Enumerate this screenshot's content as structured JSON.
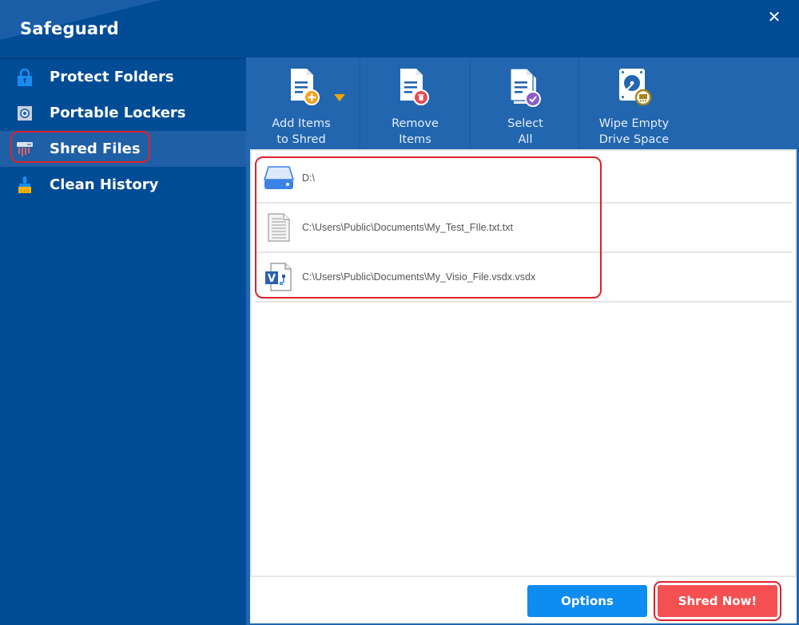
{
  "window": {
    "title": "Safeguard",
    "close_icon": "close-icon",
    "close_glyph": "✕"
  },
  "sidebar": {
    "items": [
      {
        "label": "Protect Folders",
        "icon": "lock-icon",
        "active": false
      },
      {
        "label": "Portable Lockers",
        "icon": "safe-icon",
        "active": false
      },
      {
        "label": "Shred Files",
        "icon": "shredder-icon",
        "active": true
      },
      {
        "label": "Clean History",
        "icon": "broom-icon",
        "active": false
      }
    ]
  },
  "toolbar": {
    "buttons": [
      {
        "label_line1": "Add Items",
        "label_line2": "to Shred",
        "icon": "add-document-icon",
        "has_dropdown": true
      },
      {
        "label_line1": "Remove",
        "label_line2": "Items",
        "icon": "remove-document-icon"
      },
      {
        "label_line1": "Select",
        "label_line2": "All",
        "icon": "select-all-icon"
      },
      {
        "label_line1": "Wipe Empty",
        "label_line2": "Drive Space",
        "icon": "wipe-drive-icon"
      }
    ]
  },
  "file_list": {
    "items": [
      {
        "path": "D:\\",
        "icon": "drive-icon"
      },
      {
        "path": "C:\\Users\\Public\\Documents\\My_Test_FIle.txt.txt",
        "icon": "text-file-icon"
      },
      {
        "path": "C:\\Users\\Public\\Documents\\My_Visio_File.vsdx.vsdx",
        "icon": "visio-file-icon"
      }
    ]
  },
  "footer": {
    "options_label": "Options",
    "shred_label": "Shred Now!"
  },
  "colors": {
    "background": "#024c96",
    "panel": "#2266b0",
    "active_nav": "#1f5fa6",
    "options_button": "#0f8cf0",
    "shred_button": "#f45052",
    "highlight": "#e0212b"
  }
}
